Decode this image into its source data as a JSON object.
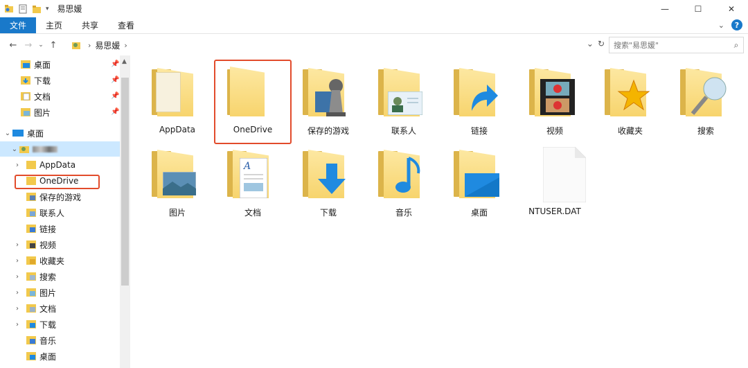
{
  "window": {
    "title": "易思媛",
    "controls": {
      "minimize": "—",
      "maximize": "☐",
      "close": "✕"
    }
  },
  "ribbon": {
    "tabs": [
      "文件",
      "主页",
      "共享",
      "查看"
    ]
  },
  "address": {
    "breadcrumb": [
      "易思媛"
    ],
    "search_placeholder": "搜索\"易思媛\""
  },
  "nav": {
    "quick_access": [
      {
        "label": "桌面",
        "icon": "desktop-folder-icon"
      },
      {
        "label": "下载",
        "icon": "download-folder-icon"
      },
      {
        "label": "文档",
        "icon": "documents-folder-icon"
      },
      {
        "label": "图片",
        "icon": "pictures-folder-icon"
      }
    ],
    "root": "桌面",
    "user": "",
    "children": [
      {
        "label": "AppData",
        "expandable": true
      },
      {
        "label": "OneDrive",
        "expandable": false
      },
      {
        "label": "保存的游戏",
        "expandable": false
      },
      {
        "label": "联系人",
        "expandable": false
      },
      {
        "label": "链接",
        "expandable": false
      },
      {
        "label": "视频",
        "expandable": true
      },
      {
        "label": "收藏夹",
        "expandable": true
      },
      {
        "label": "搜索",
        "expandable": true
      },
      {
        "label": "图片",
        "expandable": true
      },
      {
        "label": "文档",
        "expandable": true
      },
      {
        "label": "下载",
        "expandable": true
      },
      {
        "label": "音乐",
        "expandable": false
      },
      {
        "label": "桌面",
        "expandable": false
      }
    ]
  },
  "content": {
    "items": [
      {
        "label": "AppData",
        "icon": "appdata-folder-icon"
      },
      {
        "label": "OneDrive",
        "icon": "onedrive-folder-icon"
      },
      {
        "label": "保存的游戏",
        "icon": "saved-games-folder-icon"
      },
      {
        "label": "联系人",
        "icon": "contacts-folder-icon"
      },
      {
        "label": "链接",
        "icon": "links-folder-icon"
      },
      {
        "label": "视频",
        "icon": "videos-folder-icon"
      },
      {
        "label": "收藏夹",
        "icon": "favorites-folder-icon"
      },
      {
        "label": "搜索",
        "icon": "searches-folder-icon"
      },
      {
        "label": "图片",
        "icon": "pictures-folder-icon"
      },
      {
        "label": "文档",
        "icon": "documents-folder-icon"
      },
      {
        "label": "下载",
        "icon": "downloads-folder-icon"
      },
      {
        "label": "音乐",
        "icon": "music-folder-icon"
      },
      {
        "label": "桌面",
        "icon": "desktop-folder-icon"
      },
      {
        "label": "NTUSER.DAT",
        "icon": "file-icon"
      }
    ]
  },
  "colors": {
    "accent": "#1979ca",
    "annotation": "#e24b2b",
    "folder": "#f7d46d"
  }
}
